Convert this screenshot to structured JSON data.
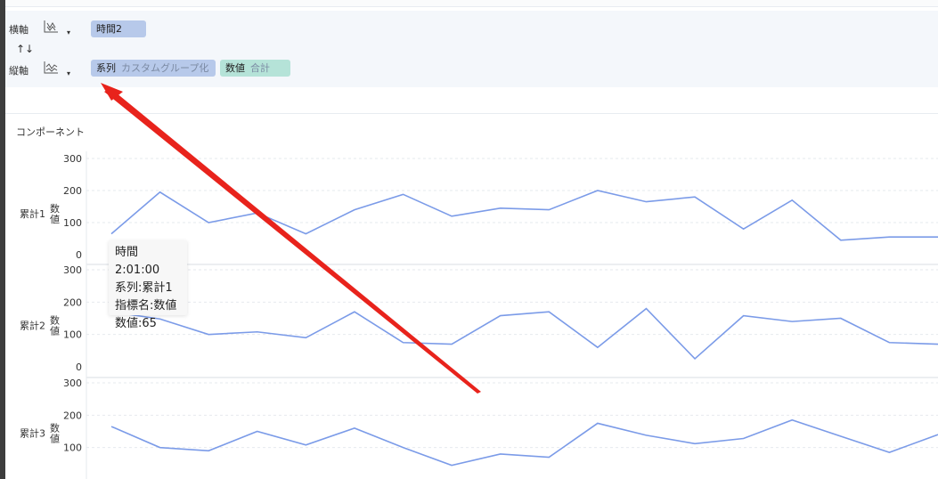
{
  "axes": {
    "horizontal": {
      "label": "横軸",
      "icon": "column-chart-icon",
      "pill": "時間2"
    },
    "swap_icon": "↑↓",
    "vertical": {
      "label": "縦軸",
      "icon": "line-chart-icon",
      "pills": [
        {
          "main": "系列",
          "sub": "カスタムグループ化",
          "color": "#b7c9ea"
        },
        {
          "main": "数値",
          "sub": "合計",
          "color": "#b5e3d8"
        }
      ]
    }
  },
  "component_title": "コンポーネント",
  "tooltip": {
    "line1": "時間2:01:00",
    "line2": "系列:累計1",
    "line3": "指標名:数値",
    "line4": "数値:65"
  },
  "colors": {
    "line": "#7b9be8",
    "arrow": "#e8231c",
    "grid": "#e6e9ee"
  },
  "chart_data": [
    {
      "type": "line",
      "row_label": "累計1",
      "ylabel": "数値",
      "yticks": [
        "300",
        "200",
        "100",
        "0"
      ],
      "ylim": [
        0,
        300
      ],
      "values": [
        65,
        195,
        100,
        130,
        65,
        140,
        188,
        120,
        145,
        140,
        200,
        165,
        180,
        80,
        170,
        45,
        55,
        55
      ]
    },
    {
      "type": "line",
      "row_label": "累計2",
      "ylabel": "数値",
      "yticks": [
        "300",
        "200",
        "100",
        "0"
      ],
      "ylim": [
        0,
        300
      ],
      "values": [
        170,
        148,
        100,
        108,
        90,
        170,
        75,
        70,
        158,
        170,
        60,
        180,
        25,
        158,
        140,
        150,
        75,
        70
      ]
    },
    {
      "type": "line",
      "row_label": "累計3",
      "ylabel": "数値",
      "yticks": [
        "300",
        "200",
        "100"
      ],
      "ylim": [
        0,
        300
      ],
      "values": [
        165,
        100,
        90,
        150,
        108,
        160,
        100,
        45,
        80,
        70,
        175,
        138,
        112,
        128,
        185,
        135,
        85,
        140
      ]
    }
  ]
}
